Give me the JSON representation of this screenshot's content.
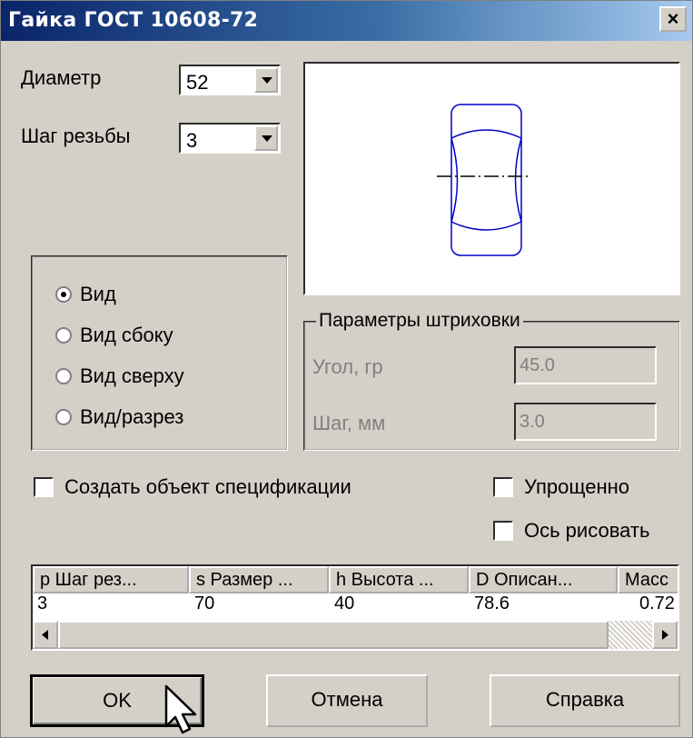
{
  "window": {
    "title": "Гайка ГОСТ 10608-72",
    "close_label": "×"
  },
  "params": {
    "diameter_label": "Диаметр",
    "diameter_value": "52",
    "pitch_label": "Шаг резьбы",
    "pitch_value": "3"
  },
  "views": {
    "items": [
      {
        "label": "Вид",
        "selected": true
      },
      {
        "label": "Вид сбоку",
        "selected": false
      },
      {
        "label": "Вид сверху",
        "selected": false
      },
      {
        "label": "Вид/разрез",
        "selected": false
      }
    ]
  },
  "hatch": {
    "title": "Параметры штриховки",
    "angle_label": "Угол, гр",
    "angle_value": "45.0",
    "step_label": "Шаг, мм",
    "step_value": "3.0"
  },
  "options": {
    "spec_label": "Создать объект спецификации",
    "simplified_label": "Упрощенно",
    "axis_label": "Ось рисовать"
  },
  "table": {
    "columns": [
      "p Шаг рез...",
      "s Размер ...",
      "h Высота ...",
      "D Описан...",
      "Масс"
    ],
    "rows": [
      [
        "3",
        "70",
        "40",
        "78.6",
        "0.72"
      ]
    ]
  },
  "buttons": {
    "ok": "OK",
    "cancel": "Отмена",
    "help": "Справка"
  },
  "colors": {
    "title_start": "#0a246a",
    "title_end": "#a6caf0",
    "face": "#d4d0c8",
    "drawing": "#0000cc"
  }
}
